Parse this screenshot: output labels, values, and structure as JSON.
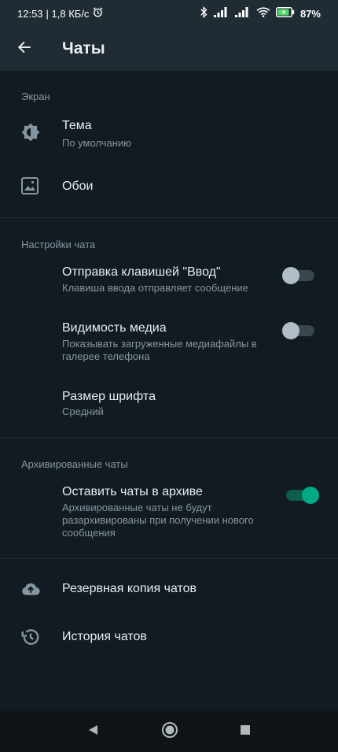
{
  "status_bar": {
    "time": "12:53",
    "net_speed": "| 1,8 КБ/с",
    "battery": "87%"
  },
  "app_bar": {
    "title": "Чаты"
  },
  "sections": {
    "screen": {
      "header": "Экран",
      "theme_title": "Тема",
      "theme_value": "По умолчанию",
      "wallpaper_title": "Обои"
    },
    "chat_settings": {
      "header": "Настройки чата",
      "enter_send_title": "Отправка клавишей \"Ввод\"",
      "enter_send_sub": "Клавиша ввода отправляет сообщение",
      "enter_send_on": false,
      "media_visibility_title": "Видимость медиа",
      "media_visibility_sub": "Показывать загруженные медиафайлы в галерее телефона",
      "media_visibility_on": false,
      "font_size_title": "Размер шрифта",
      "font_size_value": "Средний"
    },
    "archived": {
      "header": "Архивированные чаты",
      "keep_archived_title": "Оставить чаты в архиве",
      "keep_archived_sub": "Архивированные чаты не будут разархивированы при получении нового сообщения",
      "keep_archived_on": true
    },
    "misc": {
      "backup_title": "Резервная копия чатов",
      "history_title": "История чатов"
    }
  },
  "colors": {
    "background": "#121b22",
    "appbar": "#1f2c34",
    "accent": "#00a884",
    "secondary_text": "#8696a0"
  },
  "icons": [
    "back-arrow-icon",
    "theme-icon",
    "wallpaper-icon",
    "backup-cloud-icon",
    "history-icon",
    "alarm-icon",
    "bluetooth-icon",
    "signal-icon",
    "wifi-icon",
    "battery-icon",
    "nav-back-icon",
    "nav-home-icon",
    "nav-recents-icon"
  ]
}
